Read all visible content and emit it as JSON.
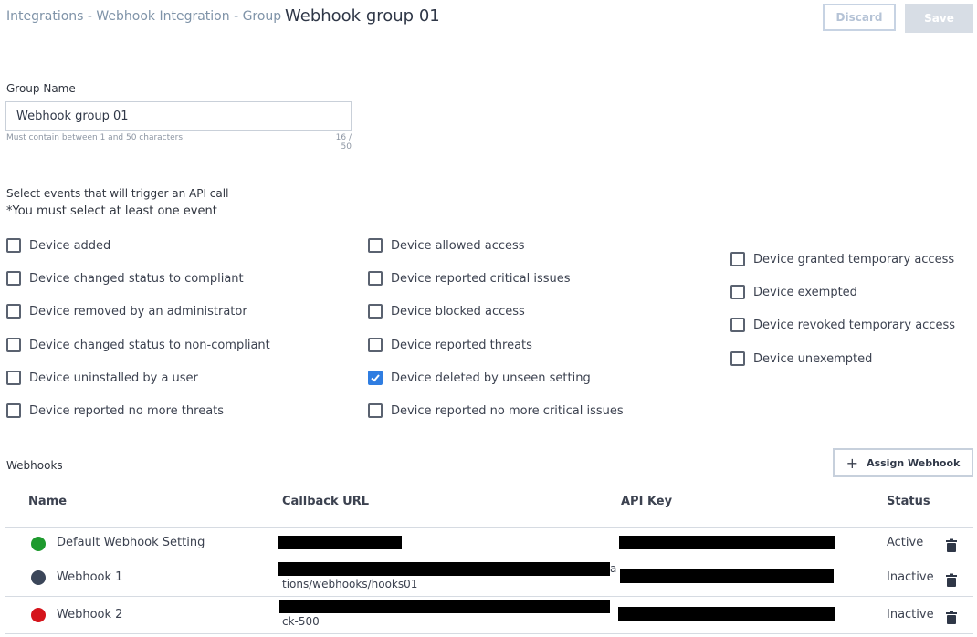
{
  "header": {
    "breadcrumb": "Integrations - Webhook Integration - Group",
    "title": "Webhook group 01",
    "discard_label": "Discard",
    "save_label": "Save"
  },
  "form": {
    "group_name_label": "Group Name",
    "group_name_value": "Webhook group 01",
    "helper_text": "Must contain between 1 and 50 characters",
    "char_count": "16 / 50"
  },
  "events": {
    "title": "Select events that will trigger an API call",
    "note": "*You must select at least one event",
    "columns": [
      [
        {
          "label": "Device added",
          "checked": false
        },
        {
          "label": "Device changed status to compliant",
          "checked": false
        },
        {
          "label": "Device removed by an administrator",
          "checked": false
        },
        {
          "label": "Device changed status to non-compliant",
          "checked": false
        },
        {
          "label": "Device uninstalled by a user",
          "checked": false
        },
        {
          "label": "Device reported no more threats",
          "checked": false
        }
      ],
      [
        {
          "label": "Device allowed access",
          "checked": false
        },
        {
          "label": "Device reported critical issues",
          "checked": false
        },
        {
          "label": "Device blocked access",
          "checked": false
        },
        {
          "label": "Device reported threats",
          "checked": false
        },
        {
          "label": "Device deleted by unseen setting",
          "checked": true
        },
        {
          "label": "Device reported no more critical issues",
          "checked": false
        }
      ],
      [
        {
          "label": "Device granted temporary access",
          "checked": false
        },
        {
          "label": "Device exempted",
          "checked": false
        },
        {
          "label": "Device revoked temporary access",
          "checked": false
        },
        {
          "label": "Device unexempted",
          "checked": false
        }
      ]
    ]
  },
  "webhooks": {
    "title": "Webhooks",
    "assign_label": "Assign Webhook",
    "columns": {
      "name": "Name",
      "url": "Callback URL",
      "key": "API Key",
      "status": "Status"
    },
    "rows": [
      {
        "name": "Default Webhook Setting",
        "status": "Active",
        "color": "#1e9a2e",
        "url_visible_tail": "",
        "url_stray": ""
      },
      {
        "name": "Webhook 1",
        "status": "Inactive",
        "color": "#3b4659",
        "url_visible_tail": "tions/webhooks/hooks01",
        "url_stray": "a"
      },
      {
        "name": "Webhook 2",
        "status": "Inactive",
        "color": "#d5141b",
        "url_visible_tail": "ck-500",
        "url_stray": ""
      }
    ]
  },
  "colors": {
    "accent": "#2f7de1",
    "active_dot": "#1e9a2e",
    "inactive_dot": "#3b4659",
    "error_dot": "#d5141b"
  },
  "icons": {
    "assign": "plus-icon",
    "delete": "trash-icon"
  }
}
